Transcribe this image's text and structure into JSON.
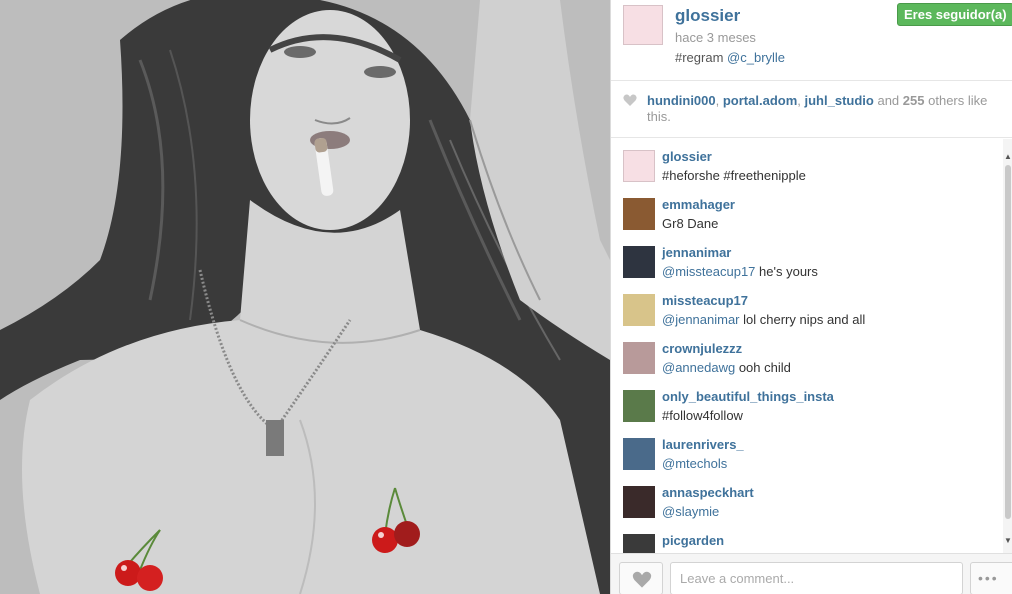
{
  "post": {
    "owner": {
      "username": "glossier",
      "time_ago": "hace 3 meses",
      "caption_tag": "#regram",
      "caption_mention": "@c_brylle",
      "avatar_color": "#f7dfe4"
    },
    "follow_label": "Eres seguidor(a)"
  },
  "likes": {
    "users": [
      "hundini000",
      "portal.adom",
      "juhl_studio"
    ],
    "separator": ", ",
    "and_text": "and",
    "count": "255",
    "others_text": "others like this."
  },
  "comments": [
    {
      "user": "glossier",
      "mention": "",
      "text": "#heforshe #freethenipple",
      "avatar": "#f7dfe4"
    },
    {
      "user": "emmahager",
      "mention": "",
      "text": "Gr8 Dane",
      "avatar": "#8a5a32"
    },
    {
      "user": "jennanimar",
      "mention": "@missteacup17",
      "text": "he's yours",
      "avatar": "#2e3440"
    },
    {
      "user": "missteacup17",
      "mention": "@jennanimar",
      "text": "lol cherry nips and all",
      "avatar": "#d8c48a"
    },
    {
      "user": "crownjulezzz",
      "mention": "@annedawg",
      "text": "ooh child",
      "avatar": "#b89a9a"
    },
    {
      "user": "only_beautiful_things_insta",
      "mention": "",
      "text": "#follow4follow",
      "avatar": "#5a7a4a"
    },
    {
      "user": "laurenrivers_",
      "mention": "@mtechols",
      "text": "",
      "avatar": "#4a6a8a"
    },
    {
      "user": "annaspeckhart",
      "mention": "@slaymie",
      "text": "",
      "avatar": "#3a2a2a"
    },
    {
      "user": "picgarden",
      "mention": "",
      "text": "",
      "avatar": "#3a3a3a"
    }
  ],
  "footer": {
    "comment_placeholder": "Leave a comment...",
    "more_label": "•••"
  },
  "colors": {
    "link_blue": "#3f729b",
    "follow_green": "#5cb85c"
  }
}
